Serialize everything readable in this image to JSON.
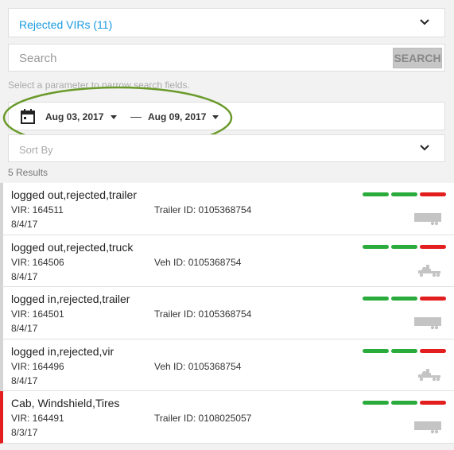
{
  "filter": {
    "selected": "Rejected VIRs (11)"
  },
  "search": {
    "placeholder": "Search",
    "button_label": "SEARCH"
  },
  "hint": "Select a parameter to narrow search fields.",
  "date_range": {
    "start": "Aug 03, 2017",
    "separator": "—",
    "end": "Aug 09, 2017"
  },
  "sort": {
    "placeholder": "Sort By"
  },
  "results_count": "5 Results",
  "colors": {
    "accent": "#1a9be0",
    "status_ok": "#2aab3c",
    "status_bad": "#e31e1e",
    "annotation": "#6a9a2a"
  },
  "records": [
    {
      "title": "logged out,rejected,trailer",
      "vir": "VIR: 164511",
      "id": "Trailer ID: 0105368754",
      "date": "8/4/17",
      "vehicle_icon": "trailer-icon",
      "flagged": false,
      "status": [
        "ok",
        "ok",
        "bad"
      ]
    },
    {
      "title": "logged out,rejected,truck",
      "vir": "VIR: 164506",
      "id": "Veh ID: 0105368754",
      "date": "8/4/17",
      "vehicle_icon": "truck-icon",
      "flagged": false,
      "status": [
        "ok",
        "ok",
        "bad"
      ]
    },
    {
      "title": "logged in,rejected,trailer",
      "vir": "VIR: 164501",
      "id": "Trailer ID: 0105368754",
      "date": "8/4/17",
      "vehicle_icon": "trailer-icon",
      "flagged": false,
      "status": [
        "ok",
        "ok",
        "bad"
      ]
    },
    {
      "title": "logged in,rejected,vir",
      "vir": "VIR: 164496",
      "id": "Veh ID: 0105368754",
      "date": "8/4/17",
      "vehicle_icon": "truck-icon",
      "flagged": false,
      "status": [
        "ok",
        "ok",
        "bad"
      ]
    },
    {
      "title": "Cab, Windshield,Tires",
      "vir": "VIR: 164491",
      "id": "Trailer ID: 0108025057",
      "date": "8/3/17",
      "vehicle_icon": "trailer-icon",
      "flagged": true,
      "status": [
        "ok",
        "ok",
        "bad"
      ]
    }
  ]
}
